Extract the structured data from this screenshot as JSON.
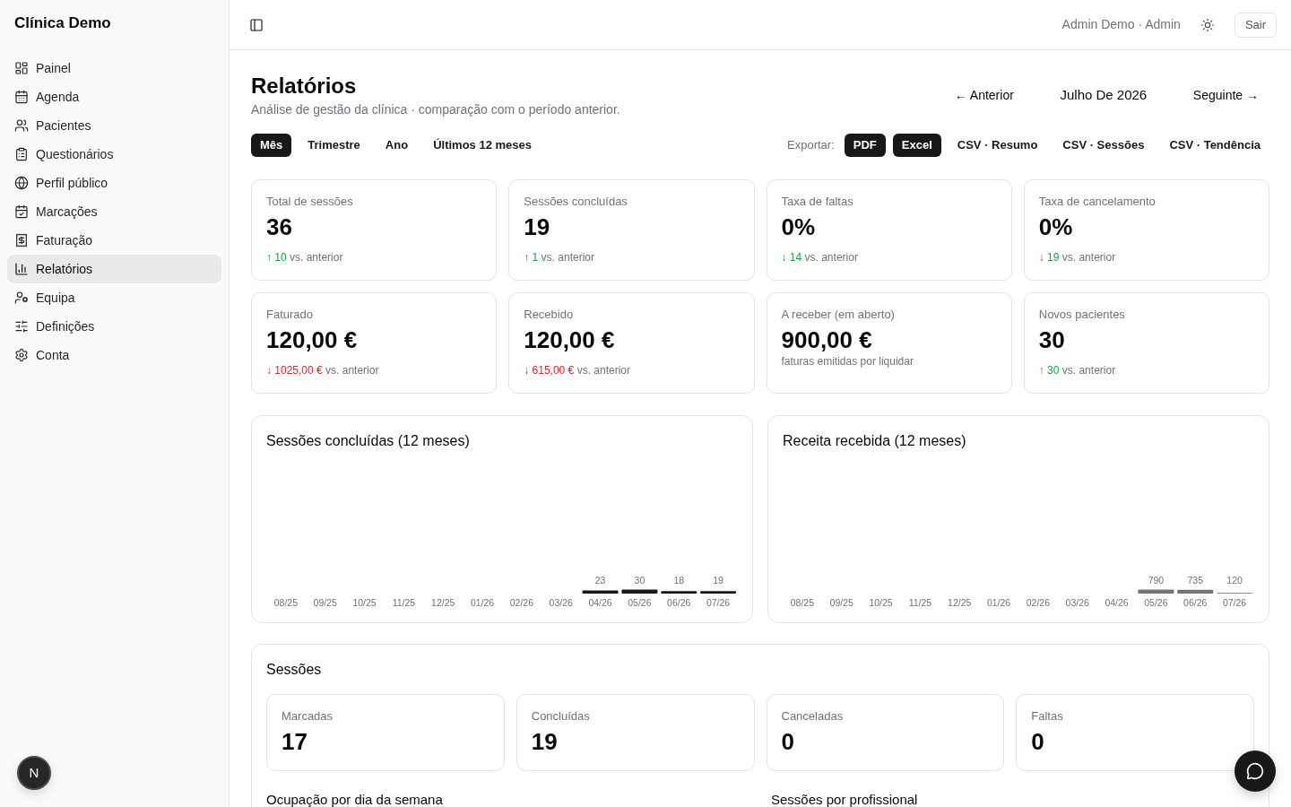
{
  "sidebar": {
    "brand": "Clínica Demo",
    "items": [
      {
        "label": "Painel",
        "selected": false
      },
      {
        "label": "Agenda",
        "selected": false
      },
      {
        "label": "Pacientes",
        "selected": false
      },
      {
        "label": "Questionários",
        "selected": false
      },
      {
        "label": "Perfil público",
        "selected": false
      },
      {
        "label": "Marcações",
        "selected": false
      },
      {
        "label": "Faturação",
        "selected": false
      },
      {
        "label": "Relatórios",
        "selected": true
      },
      {
        "label": "Equipa",
        "selected": false
      },
      {
        "label": "Definições",
        "selected": false
      },
      {
        "label": "Conta",
        "selected": false
      }
    ],
    "dev_indicator": "N"
  },
  "topbar": {
    "user": "Admin Demo · Admin",
    "logout": "Sair"
  },
  "page": {
    "title": "Relatórios",
    "subtitle": "Análise de gestão da clínica · comparação com o período anterior.",
    "period_nav": {
      "previous": "← Anterior",
      "current": "Julho De 2026",
      "next": "Seguinte →"
    }
  },
  "period_tabs": [
    {
      "label": "Mês",
      "selected": true
    },
    {
      "label": "Trimestre",
      "selected": false
    },
    {
      "label": "Ano",
      "selected": false
    },
    {
      "label": "Últimos 12 meses",
      "selected": false
    }
  ],
  "export": {
    "label": "Exportar:",
    "buttons": [
      {
        "label": "PDF",
        "kind": "solid"
      },
      {
        "label": "Excel",
        "kind": "solid"
      },
      {
        "label": "CSV · Resumo",
        "kind": "ghost"
      },
      {
        "label": "CSV · Sessões",
        "kind": "ghost"
      },
      {
        "label": "CSV · Tendência",
        "kind": "ghost"
      }
    ]
  },
  "kpis": [
    {
      "label": "Total de sessões",
      "value": "36",
      "delta": {
        "value": "↑ 10",
        "suffix": "vs. anterior",
        "favorable": true
      }
    },
    {
      "label": "Sessões concluídas",
      "value": "19",
      "delta": {
        "value": "↑ 1",
        "suffix": "vs. anterior",
        "favorable": true
      }
    },
    {
      "label": "Taxa de faltas",
      "value": "0%",
      "delta": {
        "value": "↓ 14",
        "suffix": "vs. anterior",
        "favorable": true
      }
    },
    {
      "label": "Taxa de cancelamento",
      "value": "0%",
      "delta": {
        "value": "↓ 19",
        "suffix": "vs. anterior",
        "favorable": true
      }
    },
    {
      "label": "Faturado",
      "value": "120,00 €",
      "delta": {
        "value": "↓ 1025,00 €",
        "suffix": "vs. anterior",
        "favorable": false
      }
    },
    {
      "label": "Recebido",
      "value": "120,00 €",
      "delta": {
        "value": "↓ 615,00 €",
        "suffix": "vs. anterior",
        "favorable": false
      }
    },
    {
      "label": "A receber (em aberto)",
      "value": "900,00 €",
      "note": "faturas emitidas por liquidar"
    },
    {
      "label": "Novos pacientes",
      "value": "30",
      "delta": {
        "value": "↑ 30",
        "suffix": "vs. anterior",
        "favorable": true
      }
    }
  ],
  "charts": [
    {
      "chart_data": {
        "type": "bar",
        "title": "Sessões concluídas (12 meses)",
        "categories": [
          "08/25",
          "09/25",
          "10/25",
          "11/25",
          "12/25",
          "01/26",
          "02/26",
          "03/26",
          "04/26",
          "05/26",
          "06/26",
          "07/26"
        ],
        "series": [
          {
            "color": "#18181b",
            "values": [
              null,
              null,
              null,
              null,
              null,
              null,
              null,
              null,
              23,
              30,
              18,
              19
            ]
          }
        ],
        "data_labels": true
      }
    },
    {
      "chart_data": {
        "type": "bar",
        "title": "Receita recebida (12 meses)",
        "categories": [
          "08/25",
          "09/25",
          "10/25",
          "11/25",
          "12/25",
          "01/26",
          "02/26",
          "03/26",
          "04/26",
          "05/26",
          "06/26",
          "07/26"
        ],
        "series": [
          {
            "color": "#737373",
            "values": [
              null,
              null,
              null,
              null,
              null,
              null,
              null,
              null,
              null,
              790,
              735,
              120
            ]
          }
        ],
        "data_labels": true
      }
    }
  ],
  "sessions": {
    "title": "Sessões",
    "stats": [
      {
        "label": "Marcadas",
        "value": "17"
      },
      {
        "label": "Concluídas",
        "value": "19"
      },
      {
        "label": "Canceladas",
        "value": "0"
      },
      {
        "label": "Faltas",
        "value": "0"
      }
    ],
    "sections": [
      "Ocupação por dia da semana",
      "Sessões por profissional"
    ]
  }
}
